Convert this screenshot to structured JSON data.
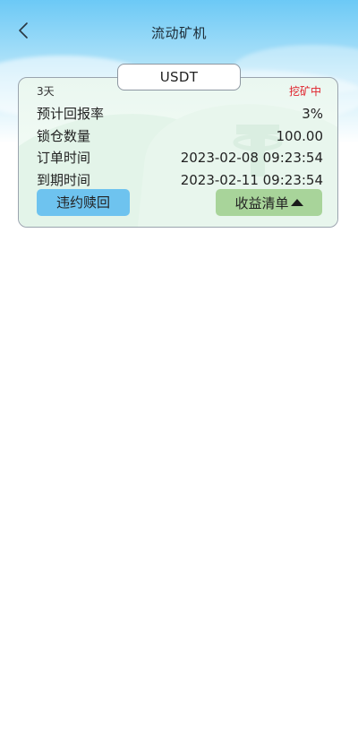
{
  "header": {
    "title": "流动矿机",
    "back_icon": "chevron-left-icon"
  },
  "order": {
    "coin": "USDT",
    "period": "3天",
    "status": "挖矿中",
    "status_color": "#e0212a",
    "rows": [
      {
        "label": "预计回报率",
        "value": "3%"
      },
      {
        "label": "锁仓数量",
        "value": "100.00"
      },
      {
        "label": "订单时间",
        "value": "2023-02-08 09:23:54"
      },
      {
        "label": "到期时间",
        "value": "2023-02-11 09:23:54"
      }
    ],
    "redeem_label": "违约赎回",
    "redeem_color": "#6ec3ef",
    "earnings_label": "收益清单",
    "earnings_color": "#a8d49a",
    "earnings_icon": "caret-up-icon",
    "watermark_icon": "tether-logo-icon"
  }
}
